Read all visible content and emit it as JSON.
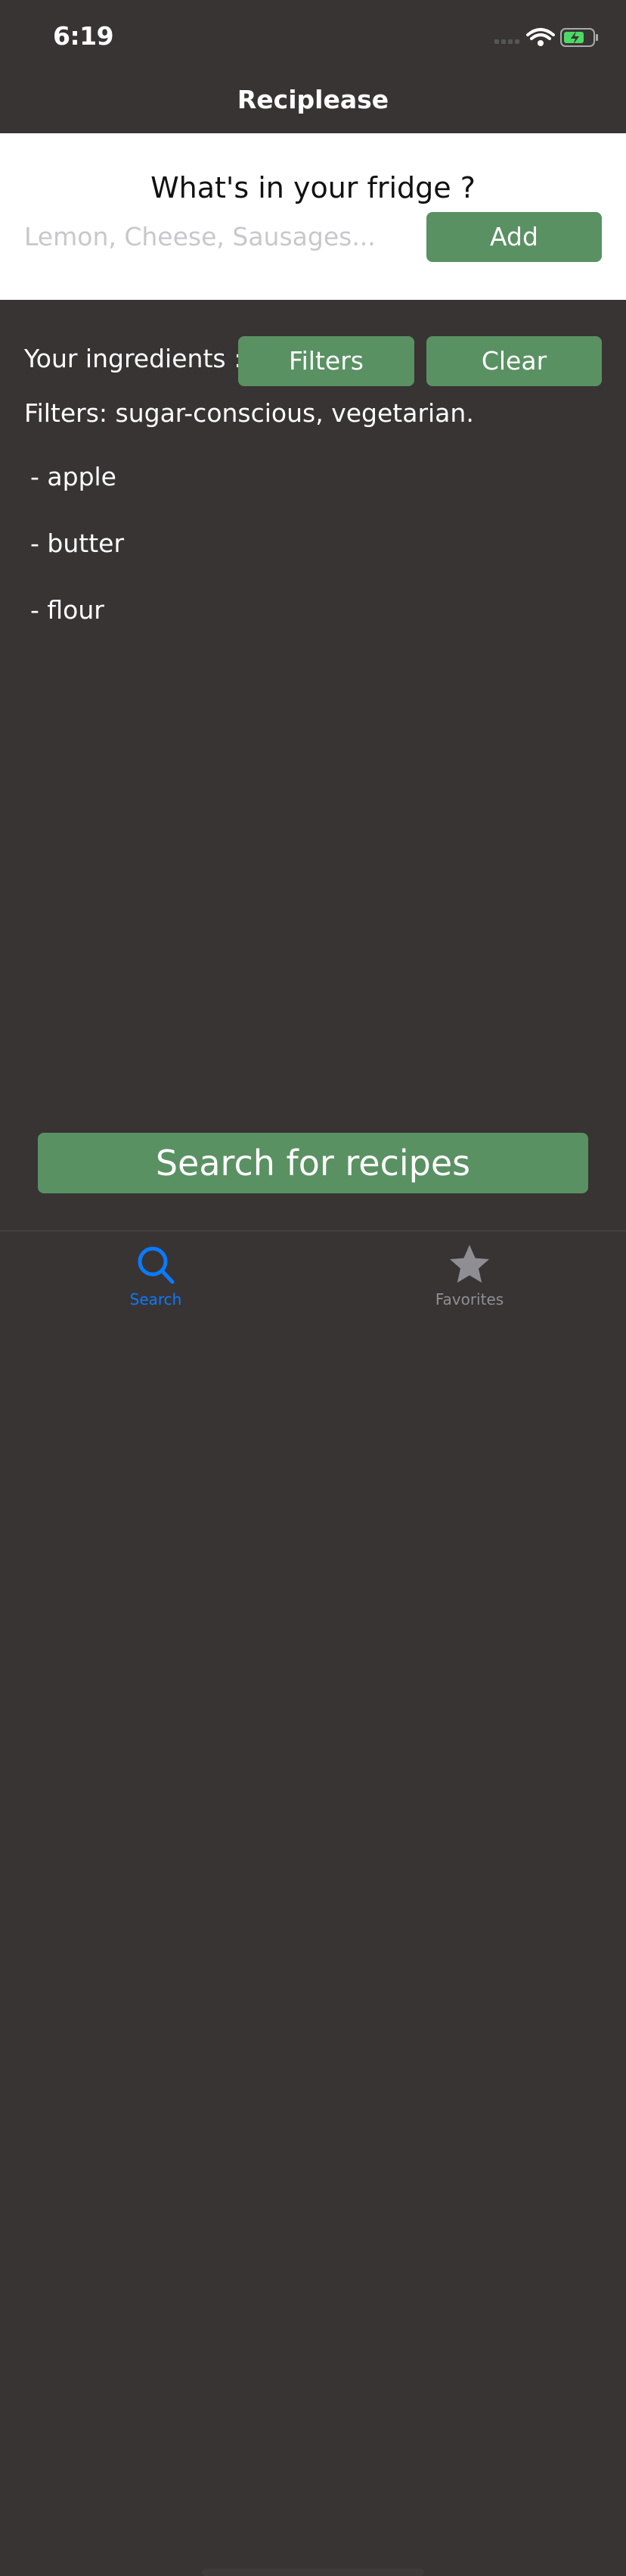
{
  "status_bar": {
    "time": "6:19"
  },
  "nav": {
    "title": "Reciplease"
  },
  "fridge": {
    "question": "What's in your fridge ?",
    "input_placeholder": "Lemon, Cheese, Sausages...",
    "input_value": "",
    "add_label": "Add"
  },
  "ingredients": {
    "label": "Your ingredients :",
    "filters_label": "Filters",
    "clear_label": "Clear",
    "filters_text": "Filters: sugar-conscious, vegetarian.",
    "items": [
      "- apple",
      "- butter",
      "- flour"
    ]
  },
  "search_button": {
    "label": "Search for recipes"
  },
  "tab_bar": {
    "tabs": [
      {
        "label": "Search",
        "icon": "search-icon",
        "selected": true
      },
      {
        "label": "Favorites",
        "icon": "star-icon",
        "selected": false
      }
    ]
  },
  "colors": {
    "background": "#383434",
    "button_green": "#5a9163",
    "tab_active": "#0a7aff",
    "tab_inactive": "#8e8e93",
    "battery_green": "#4cd964"
  }
}
